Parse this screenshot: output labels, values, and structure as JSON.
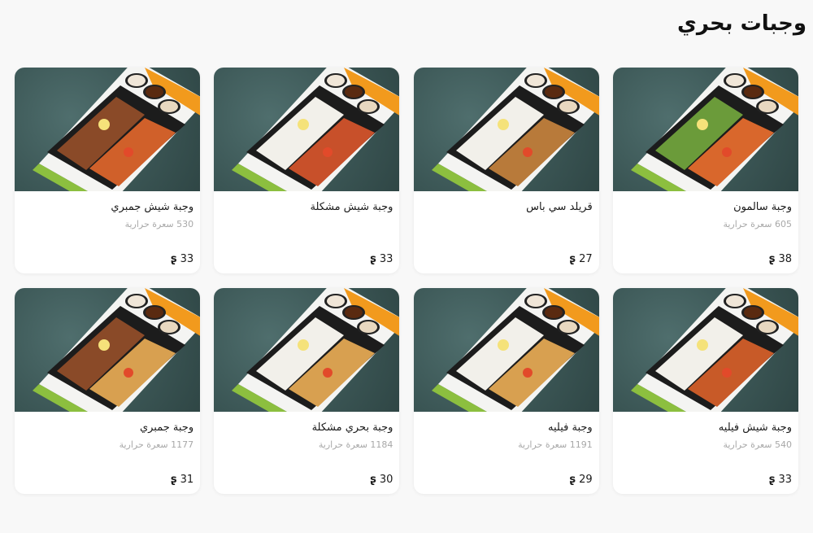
{
  "section": {
    "title": "وجبات بحري"
  },
  "currency_icon": "saudi-riyal-icon",
  "meals": [
    {
      "name": "وجبة سالمون",
      "calories": "605 سعرة حرارية",
      "price": "38",
      "dish": "salmon"
    },
    {
      "name": "قريلد سي باس",
      "calories": "",
      "price": "27",
      "dish": "seabass"
    },
    {
      "name": "وجبة شيش مشكلة",
      "calories": "",
      "price": "33",
      "dish": "mixed-skewers"
    },
    {
      "name": "وجبة شيش جمبري",
      "calories": "530 سعرة حرارية",
      "price": "33",
      "dish": "shrimp-skewers"
    },
    {
      "name": "وجبة شيش فيليه",
      "calories": "540 سعرة حرارية",
      "price": "33",
      "dish": "fillet-skewers"
    },
    {
      "name": "وجبة فيليه",
      "calories": "1191 سعرة حرارية",
      "price": "29",
      "dish": "fried-fillet"
    },
    {
      "name": "وجبة بحري مشكلة",
      "calories": "1184 سعرة حرارية",
      "price": "30",
      "dish": "mixed-fried"
    },
    {
      "name": "وجبة جمبري",
      "calories": "1177 سعرة حرارية",
      "price": "31",
      "dish": "fried-shrimp"
    }
  ]
}
